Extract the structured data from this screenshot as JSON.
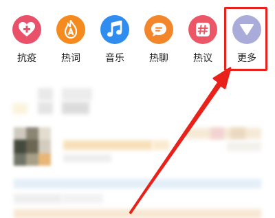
{
  "shortcuts": [
    {
      "label": "抗疫",
      "icon": "heart-plus-icon",
      "color": "#e9516a"
    },
    {
      "label": "热词",
      "icon": "flame-a-icon",
      "color": "#f58a1f"
    },
    {
      "label": "音乐",
      "icon": "music-note-icon",
      "color": "#2f8df0"
    },
    {
      "label": "热聊",
      "icon": "chat-bubble-icon",
      "color": "#f3862b"
    },
    {
      "label": "热议",
      "icon": "hashtag-icon",
      "color": "#ec5767"
    },
    {
      "label": "更多",
      "icon": "triangle-down-icon",
      "color": "#a9acd8"
    }
  ],
  "colors": {
    "highlight": "#e8221b",
    "arrow": "#e8221b"
  }
}
